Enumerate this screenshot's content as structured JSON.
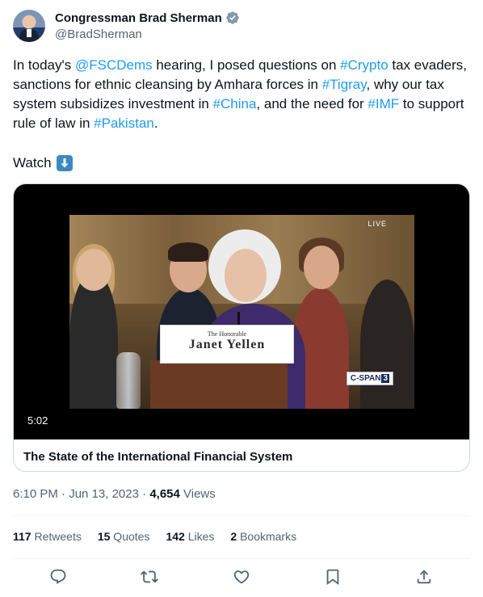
{
  "author": {
    "display_name": "Congressman Brad Sherman",
    "handle": "@BradSherman",
    "verified_icon": "verified-badge-icon",
    "verified_color": "#829aab"
  },
  "tweet": {
    "t1": "In today's ",
    "mention": "@FSCDems",
    "t2": " hearing, I posed questions on ",
    "tag_crypto": "#Crypto",
    "t3": " tax evaders, sanctions for ethnic cleansing by Amhara forces in ",
    "tag_tigray": "#Tigray",
    "t4": ", why our tax system subsidizes investment in ",
    "tag_china": "#China",
    "t5": ", and the need for ",
    "tag_imf": "#IMF",
    "t6": " to support rule of law in ",
    "tag_pakistan": "#Pakistan",
    "t7": ".",
    "watch": "Watch",
    "link_color": "#1d9bf0"
  },
  "video": {
    "live_label": "LIVE",
    "nameplate_small": "The Honorable",
    "nameplate_name": "Janet Yellen",
    "network": "C-SPAN",
    "network_num": "3",
    "duration": "5:02",
    "card_title": "The State of the International Financial System"
  },
  "meta": {
    "time": "6:10 PM",
    "sep1": " · ",
    "date": "Jun 13, 2023",
    "sep2": " · ",
    "views_count": "4,654",
    "views_label": " Views"
  },
  "stats": {
    "retweets_count": "117",
    "retweets_label": " Retweets",
    "quotes_count": "15",
    "quotes_label": " Quotes",
    "likes_count": "142",
    "likes_label": " Likes",
    "bookmarks_count": "2",
    "bookmarks_label": " Bookmarks"
  },
  "actions": [
    "reply-icon",
    "retweet-icon",
    "like-icon",
    "bookmark-icon",
    "share-icon"
  ]
}
